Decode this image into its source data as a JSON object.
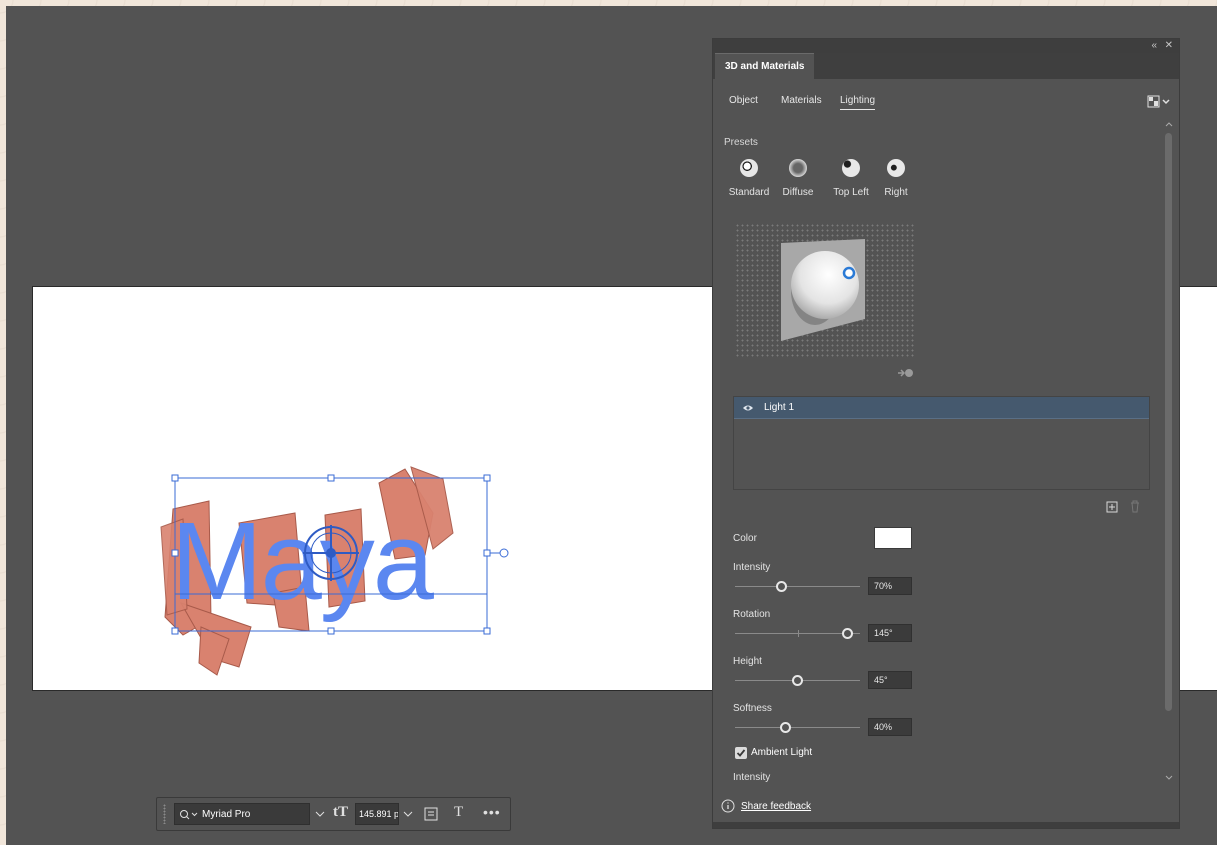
{
  "panel": {
    "title": "3D and Materials",
    "subtabs": [
      "Object",
      "Materials",
      "Lighting"
    ],
    "active_subtab": "Lighting",
    "presets_label": "Presets",
    "presets": [
      "Standard",
      "Diffuse",
      "Top Left",
      "Right"
    ],
    "lights": [
      {
        "name": "Light 1",
        "selected": true
      }
    ],
    "color_label": "Color",
    "color_value": "#ffffff",
    "intensity": {
      "label": "Intensity",
      "value": "70%",
      "fraction": 0.37
    },
    "rotation": {
      "label": "Rotation",
      "value": "145°",
      "fraction": 0.9
    },
    "height": {
      "label": "Height",
      "value": "45°",
      "fraction": 0.5
    },
    "softness": {
      "label": "Softness",
      "value": "40%",
      "fraction": 0.4
    },
    "ambient_light": {
      "label": "Ambient Light",
      "checked": true
    },
    "ambient_intensity_label": "Intensity",
    "share_feedback": "Share feedback"
  },
  "canvas": {
    "text": "Maya",
    "text_color": "#5b87f0",
    "extrusion_color": "#d9826f",
    "selection_color": "#3a6bd6"
  },
  "toolbar": {
    "font_name": "Myriad Pro",
    "font_size": "145.891 p"
  },
  "icons": [
    "search-icon",
    "chevron-down-icon",
    "text-size-icon",
    "paragraph-icon",
    "type-icon",
    "more-icon",
    "eye-icon",
    "add-light-icon",
    "delete-light-icon",
    "info-icon",
    "panel-menu-icon",
    "collapse-icon",
    "close-icon"
  ]
}
